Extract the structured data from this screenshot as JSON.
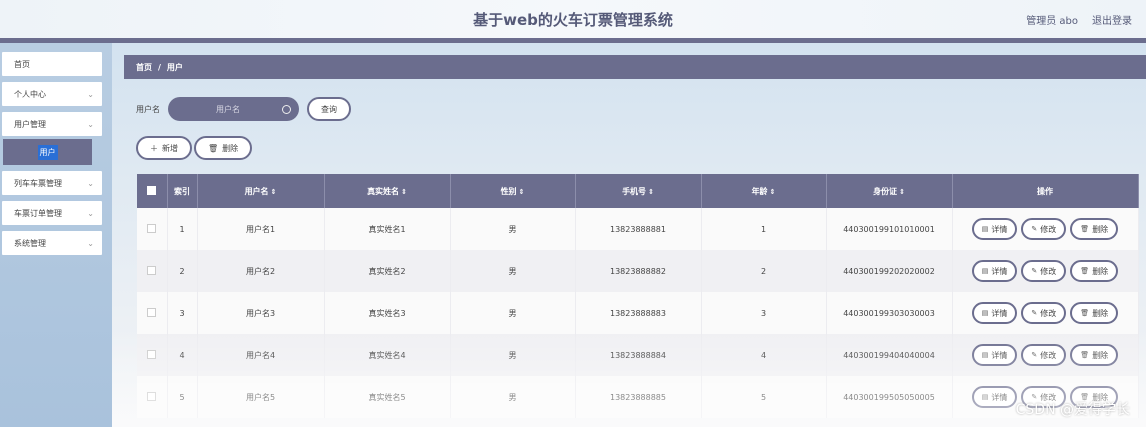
{
  "header": {
    "title": "基于web的火车订票管理系统",
    "user_label": "管理员 abo",
    "logout_label": "退出登录"
  },
  "sidebar": {
    "items": [
      {
        "label": "首页",
        "chevron": false
      },
      {
        "label": "个人中心",
        "chevron": true
      },
      {
        "label": "用户管理",
        "chevron": true
      },
      {
        "label": "列车车票管理",
        "chevron": true
      },
      {
        "label": "车票订单管理",
        "chevron": true
      },
      {
        "label": "系统管理",
        "chevron": true
      }
    ],
    "submenu_active": "用户"
  },
  "breadcrumb": {
    "home": "首页",
    "separator": "/",
    "current": "用户"
  },
  "search": {
    "label": "用户名",
    "placeholder": "用户名",
    "button": "查询"
  },
  "actions": {
    "add": "新增",
    "delete": "删除"
  },
  "table": {
    "headers": [
      "索引",
      "用户名",
      "真实姓名",
      "性别",
      "手机号",
      "年龄",
      "身份证",
      "操作"
    ],
    "rows": [
      {
        "index": "1",
        "username": "用户名1",
        "realname": "真实姓名1",
        "gender": "男",
        "phone": "13823888881",
        "age": "1",
        "idcard": "440300199101010001"
      },
      {
        "index": "2",
        "username": "用户名2",
        "realname": "真实姓名2",
        "gender": "男",
        "phone": "13823888882",
        "age": "2",
        "idcard": "440300199202020002"
      },
      {
        "index": "3",
        "username": "用户名3",
        "realname": "真实姓名3",
        "gender": "男",
        "phone": "13823888883",
        "age": "3",
        "idcard": "440300199303030003"
      },
      {
        "index": "4",
        "username": "用户名4",
        "realname": "真实姓名4",
        "gender": "男",
        "phone": "13823888884",
        "age": "4",
        "idcard": "440300199404040004"
      },
      {
        "index": "5",
        "username": "用户名5",
        "realname": "真实姓名5",
        "gender": "男",
        "phone": "13823888885",
        "age": "5",
        "idcard": "440300199505050005"
      }
    ],
    "ops": {
      "detail": "详情",
      "edit": "修改",
      "delete": "删除"
    }
  },
  "watermark": "CSDN @爱得学长",
  "colors": {
    "accent": "#6b6d8e",
    "selected": "#2a6fd6"
  }
}
